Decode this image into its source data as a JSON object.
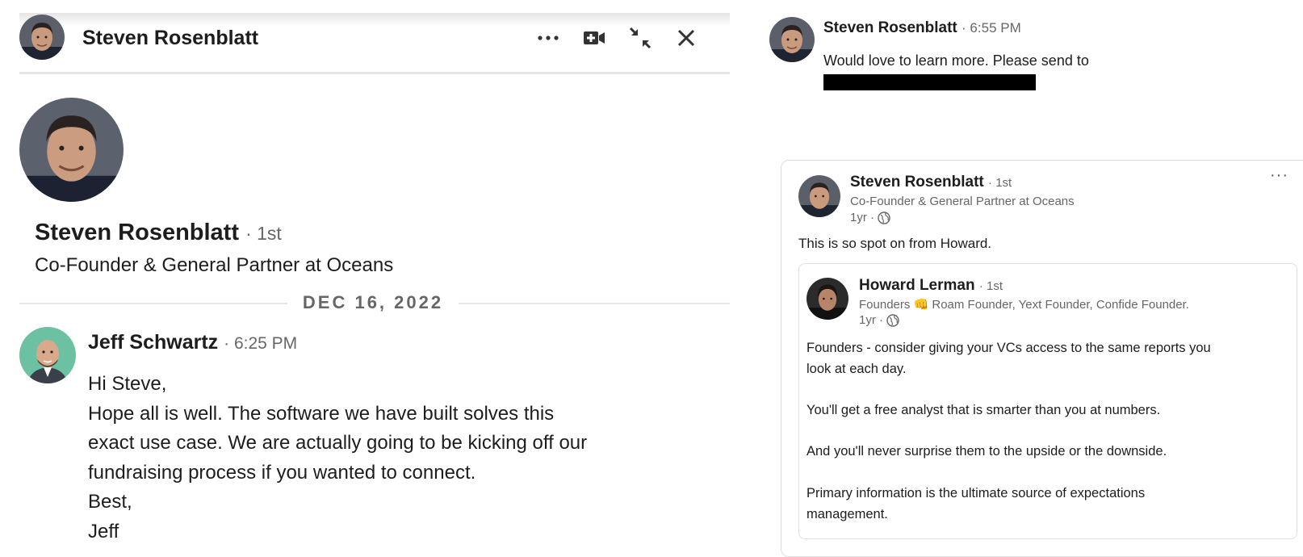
{
  "chat_window": {
    "header": {
      "name": "Steven Rosenblatt",
      "icons": [
        "more-icon",
        "video-call-icon",
        "minimize-icon",
        "close-icon"
      ]
    },
    "profile": {
      "name": "Steven Rosenblatt",
      "degree": "· 1st",
      "headline": "Co-Founder & General Partner at Oceans"
    },
    "date_divider": "DEC 16, 2022",
    "message": {
      "sender": "Jeff Schwartz",
      "time": "· 6:25 PM",
      "lines": [
        "Hi Steve,",
        "Hope all is well. The software we have built solves this",
        "exact use case. We are actually going to be kicking off our",
        "fundraising process if you wanted to connect.",
        "Best,",
        "Jeff"
      ]
    }
  },
  "reply": {
    "sender": "Steven Rosenblatt",
    "time": "· 6:55 PM",
    "text": "Would love to learn more. Please send to"
  },
  "shared_post": {
    "author": "Steven Rosenblatt",
    "degree": "· 1st",
    "headline": "Co-Founder & General Partner at Oceans",
    "age": "1yr ·",
    "text": "This is so spot on from Howard.",
    "reshared": {
      "author": "Howard Lerman",
      "degree": "· 1st",
      "headline": "Founders 👊 Roam Founder, Yext Founder, Confide Founder.",
      "age": "1yr ·",
      "body_lines": [
        "Founders - consider giving your VCs access to the same reports you",
        "look at each day.",
        "",
        "You'll get a free analyst that is smarter than you at numbers.",
        "",
        "And you'll never surprise them to the upside or the downside.",
        "",
        "Primary information is the ultimate source of expectations",
        "management."
      ]
    }
  },
  "colors": {
    "text": "#1d1d1d",
    "muted": "#666666",
    "divider": "#e6e6e6",
    "jeff_avatar_bg": "#6cc1a3"
  }
}
